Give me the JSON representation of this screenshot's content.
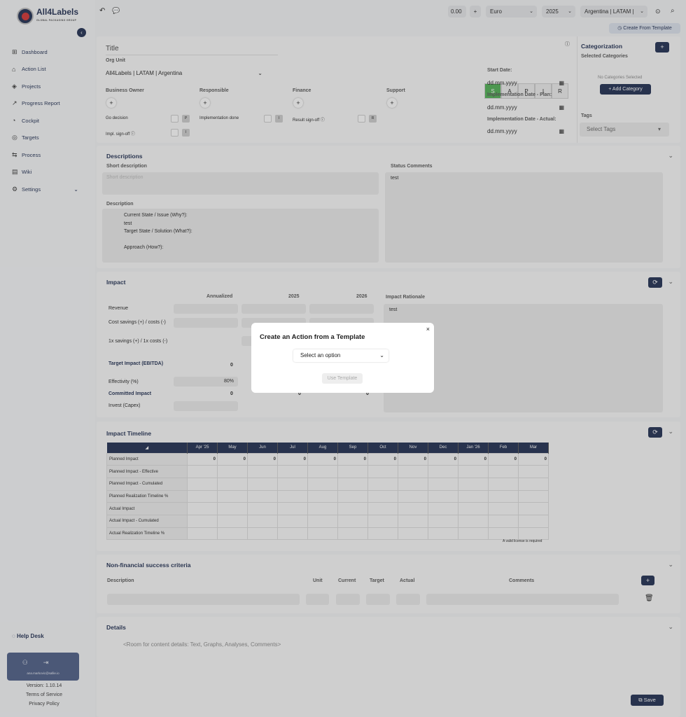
{
  "brand": {
    "name": "All4Labels",
    "tagline": "GLOBAL PACKAGING GROUP"
  },
  "nav": [
    {
      "icon": "⊞",
      "label": "Dashboard"
    },
    {
      "icon": "⌂",
      "label": "Action List"
    },
    {
      "icon": "◈",
      "label": "Projects"
    },
    {
      "icon": "↗",
      "label": "Progress Report"
    },
    {
      "icon": "◔",
      "label": "Cockpit"
    },
    {
      "icon": "◎",
      "label": "Targets"
    },
    {
      "icon": "⇆",
      "label": "Process"
    },
    {
      "icon": "▤",
      "label": "Wiki"
    },
    {
      "icon": "⚙",
      "label": "Settings"
    }
  ],
  "help": "Help Desk",
  "user": {
    "email": "ana.markovic@sallie.io"
  },
  "footer": {
    "version": "Version: 1.10.14",
    "terms": "Terms of Service",
    "privacy": "Privacy Policy"
  },
  "topbar": {
    "value": "0.00",
    "plus": "+",
    "currency": "Euro",
    "year": "2025",
    "org": "Argentina | LATAM |",
    "create_template": "Create From Template"
  },
  "form": {
    "title_placeholder": "Title",
    "org_unit_label": "Org Unit",
    "org_unit": "All4Labels | LATAM | Argentina",
    "roles": [
      "Business Owner",
      "Responsible",
      "Finance",
      "Support"
    ],
    "checks": [
      {
        "label": "Go decision",
        "tag": "P"
      },
      {
        "label": "Implementation done",
        "tag": "I"
      },
      {
        "label": "Result sign-off",
        "tag": "R"
      },
      {
        "label": "Impl. sign-off",
        "tag": "I"
      }
    ],
    "sapir": [
      "S",
      "A",
      "P",
      "I",
      "R"
    ],
    "start_label": "Start Date:",
    "plan_label": "Implementation Date - Plan:",
    "actual_label": "Implementation Date - Actual:",
    "date_placeholder": "dd.mm.yyyy",
    "categorization": "Categorization",
    "selected_categories": "Selected Categories",
    "no_categories": "No Categories Selected",
    "add_category": "+ Add Category",
    "tags_label": "Tags",
    "select_tags": "Select Tags"
  },
  "descriptions": {
    "title": "Descriptions",
    "short_label": "Short description",
    "short_placeholder": "Short description",
    "status_label": "Status Comments",
    "status_value": "test",
    "desc_label": "Description",
    "desc_lines": [
      "Current State / Issue (Why?):",
      "test",
      "Target State / Solution (What?):",
      "",
      "Approach (How?):"
    ]
  },
  "impact": {
    "title": "Impact",
    "cols": [
      "Annualized",
      "2025",
      "2026"
    ],
    "rows": [
      "Revenue",
      "Cost savings (+) / costs (-)",
      "1x savings (+) / 1x costs (-)"
    ],
    "target_label": "Target Impact (EBITDA)",
    "target_value": "0",
    "eff_label": "Effectivity (%)",
    "eff_value": "80%",
    "committed_label": "Committed Impact",
    "committed_value": "0",
    "committed_2025": "0",
    "committed_2026": "0",
    "capex_label": "Invest (Capex)",
    "rationale_label": "Impact Rationale",
    "rationale_value": "test"
  },
  "timeline": {
    "title": "Impact Timeline",
    "months": [
      "Apr '25",
      "May",
      "Jun",
      "Jul",
      "Aug",
      "Sep",
      "Oct",
      "Nov",
      "Dec",
      "Jan '26",
      "Feb",
      "Mar"
    ],
    "rows": [
      "Planned Impact",
      "Planned Impact - Effective",
      "Planned Impact - Cumulated",
      "Planned Realization Timeline %",
      "Actual Impact",
      "Actual Impact - Cumulated",
      "Actual Realization Timeline %"
    ],
    "planned_value": "0",
    "license": "A valid license is required"
  },
  "nfsc": {
    "title": "Non-financial success criteria",
    "cols": [
      "Description",
      "Unit",
      "Current",
      "Target",
      "Actual",
      "Comments"
    ]
  },
  "details": {
    "title": "Details",
    "placeholder": "<Room for content details: Text, Graphs, Analyses, Comments>"
  },
  "save": "Save",
  "modal": {
    "title": "Create an Action from a Template",
    "close": "×",
    "select": "Select an option",
    "use": "Use Template"
  }
}
